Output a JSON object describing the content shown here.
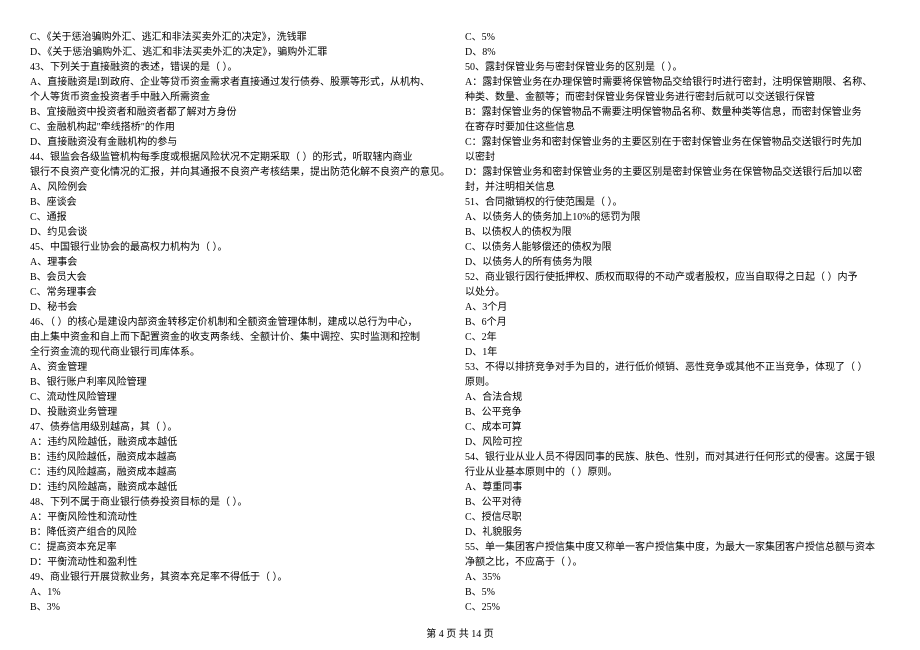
{
  "left_column": [
    "            C、《关于惩治骗购外汇、逃汇和非法买卖外汇的决定》，洗钱罪",
    "            D、《关于惩治骗购外汇、逃汇和非法买卖外汇的决定》，骗购外汇罪",
    "43、下列关于直接融资的表述，错误的是（    ）。",
    "        A、直接融资是l到政府、企业等贷币资金需求者直接通过发行债券、股票等形式，从机构、",
    "个人等货币资金投资者手中融入所需资金",
    "        B、宜接融资中投资者和融资者都了解对方身份",
    "        C、金融机构起\"牵线搭桥\"的作用",
    "        D、直接融资没有金融机构的参与",
    "44、银监会各级监管机构每季度或根据风险状况不定期采取（      ）的形式，听取辖内商业",
    "银行不良资产变化情况的汇报，并向其通报不良资产考核结果，提出防范化解不良资产的意见。",
    "        A、风险例会",
    "        B、座谈会",
    "        C、通报",
    "        D、约见会谈",
    "45、中国银行业协会的最高权力机构为（      ）。",
    "        A、理事会",
    "        B、会员大会",
    "        C、常务理事会",
    "        D、秘书会",
    "46、（      ）的核心是建设内部资金转移定价机制和全额资金管理体制，建成以总行为中心，",
    "由上集中资金和自上而下配置资金的收支两条线、全额计价、集中调控、实时监测和控制",
    "全行资金流的现代商业银行司库体系。",
    "        A、资金管理",
    "        B、银行账户利率风险管理",
    "        C、流动性风险管理",
    "        D、投融资业务管理",
    "47、债券信用级别越高，其（      ）。",
    "        A：违约风险越低，融资成本越低",
    "        B：违约风险越低，融资成本越高",
    "        C：违约风险越高，融资成本越高",
    "        D：违约风险越高，融资成本越低",
    "48、下列不属于商业银行债券投资目标的是（      ）。",
    "        A：平衡风险性和流动性",
    "        B：降低资产组合的风险",
    "        C：提高资本充足率",
    "        D：平衡流动性和盈利性",
    "49、商业银行开展贷款业务，其资本充足率不得低于（      ）。",
    "        A、1%",
    "        B、3%"
  ],
  "right_column": [
    "        C、5%",
    "        D、8%",
    "50、露封保管业务与密封保管业务的区别是（    ）。",
    "        A：露封保管业务在办理保管时需要将保管物品交给银行时进行密封，注明保管期限、名称、",
    "种类、数量、金额等；而密封保管业务保管业务进行密封后就可以交送银行保管",
    "        B：露封保管业务的保管物品不需要注明保管物品名称、数量种类等信息，而密封保管业务",
    "在寄存时要加住这些信息",
    "        C：露封保管业务和密封保管业务的主要区别在于密封保管业务在保管物品交送银行时先加",
    "以密封",
    "        D：露封保管业务和密封保管业务的主要区别是密封保管业务在保管物品交送银行后加以密",
    "封，并注明相关信息",
    "51、合同撤销权的行使范围是（    ）。",
    "        A、以债务人的债务加上10%的惩罚为限",
    "        B、以债权人的债权为限",
    "        C、以债务人能够偿还的债权为限",
    "        D、以债务人的所有债务为限",
    "52、商业银行因行使抵押权、质权而取得的不动产或者股权，应当自取得之日起（      ）内予",
    "以处分。",
    "        A、3个月",
    "        B、6个月",
    "        C、2年",
    "        D、1年",
    "53、不得以排挤竞争对手为目的，进行低价倾销、恶性竞争或其他不正当竞争，体现了（      ）",
    "原则。",
    "        A、合法合规",
    "        B、公平竞争",
    "        C、成本可算",
    "        D、风险可控",
    "54、银行业从业人员不得因同事的民族、肤色、性别，而对其进行任何形式的侵害。这属于银",
    "行业从业基本原则中的（      ）原则。",
    "        A、尊重同事",
    "        B、公平对待",
    "        C、授信尽职",
    "        D、礼貌服务",
    "55、单一集团客户授信集中度又称单一客户授信集中度，为最大一家集团客户授信总额与资本",
    "净额之比，不应高于（      ）。",
    "        A、35%",
    "        B、5%",
    "        C、25%"
  ],
  "footer": "第 4 页 共 14 页"
}
